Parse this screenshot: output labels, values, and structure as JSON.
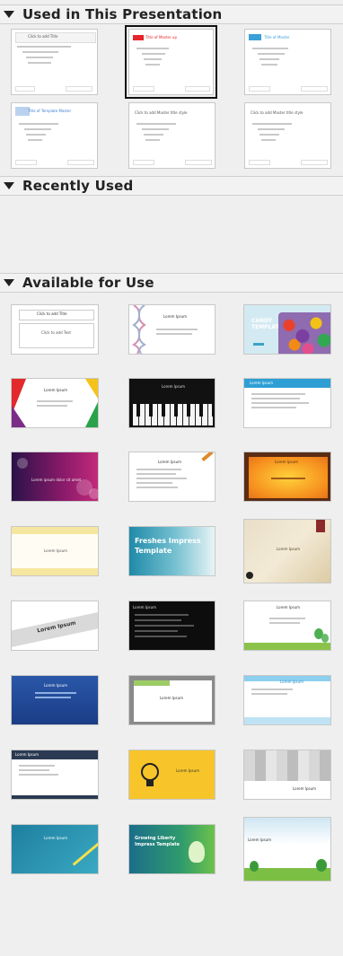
{
  "sections": {
    "used": {
      "title": "Used in This Presentation"
    },
    "recent": {
      "title": "Recently Used"
    },
    "available": {
      "title": "Available for Use"
    }
  },
  "used_thumbs": [
    {
      "title": "Click to add Title",
      "selected": false
    },
    {
      "title": "Title of Master up",
      "badge": "Master",
      "selected": true
    },
    {
      "title": "Title of Master",
      "badge": "Title",
      "selected": false
    },
    {
      "title": "Title of Template Master",
      "selected": false
    },
    {
      "title": "Click to add Master title style",
      "selected": false
    },
    {
      "title": "Click to add Master title style",
      "selected": false
    }
  ],
  "available_thumbs": [
    {
      "name": "Click to add Title",
      "sub": "Click to add Text",
      "style": "plain"
    },
    {
      "name": "Lorem Ipsum",
      "sub": "Lorem ipsum dolor sit amet",
      "style": "dna"
    },
    {
      "name": "CANDY TEMPLATE",
      "style": "candy"
    },
    {
      "name": "Lorem Ipsum",
      "style": "colorful"
    },
    {
      "name": "Lorem Ipsum",
      "style": "piano"
    },
    {
      "name": "Lorem Ipsum",
      "style": "blueline"
    },
    {
      "name": "Lorem ipsum dolor sit amet",
      "style": "bokeh"
    },
    {
      "name": "Lorem Ipsum",
      "style": "pencil"
    },
    {
      "name": "Lorem Ipsum",
      "style": "orange"
    },
    {
      "name": "Lorem Ipsum",
      "style": "yellowframe"
    },
    {
      "name": "Freshes Impress Template",
      "style": "fresh"
    },
    {
      "name": "Lorem Ipsum",
      "style": "vintage"
    },
    {
      "name": "Lorem Ipsum",
      "style": "grayband"
    },
    {
      "name": "Lorem Ipsum",
      "style": "dark"
    },
    {
      "name": "Lorem Ipsum",
      "style": "trees"
    },
    {
      "name": "Lorem Ipsum",
      "style": "bluewave"
    },
    {
      "name": "Lorem Ipsum",
      "style": "greenframe"
    },
    {
      "name": "Lorem Ipsum",
      "style": "lightblue"
    },
    {
      "name": "Lorem Ipsum",
      "style": "navyhead"
    },
    {
      "name": "Lorem Ipsum",
      "style": "bulb"
    },
    {
      "name": "Lorem Ipsum",
      "style": "pixels"
    },
    {
      "name": "Lorem Ipsum",
      "style": "teal"
    },
    {
      "name": "Growing Liberty Impress Template",
      "style": "liberty"
    },
    {
      "name": "Lorem Ipsum",
      "style": "landscape"
    }
  ]
}
